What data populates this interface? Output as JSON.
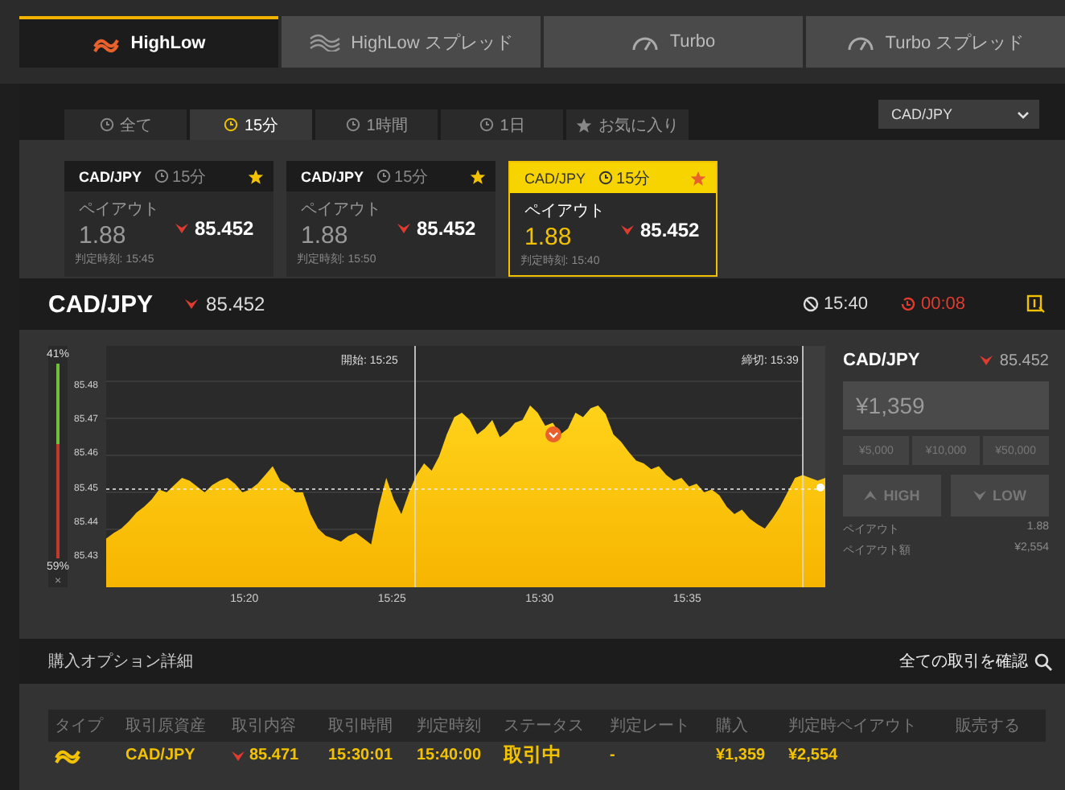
{
  "product_tabs": [
    {
      "label": "HighLow",
      "selected": true
    },
    {
      "label": "HighLow スプレッド",
      "selected": false
    },
    {
      "label": "Turbo",
      "selected": false
    },
    {
      "label": "Turbo スプレッド",
      "selected": false
    }
  ],
  "duration_tabs": [
    {
      "label": "全て",
      "selected": false
    },
    {
      "label": "15分",
      "selected": true
    },
    {
      "label": "1時間",
      "selected": false
    },
    {
      "label": "1日",
      "selected": false
    },
    {
      "label": "お気に入り",
      "selected": false
    }
  ],
  "pair_select": {
    "value": "CAD/JPY"
  },
  "option_cards": [
    {
      "pair": "CAD/JPY",
      "duration": "15分",
      "favorite": true,
      "payout_label": "ペイアウト",
      "payout": "1.88",
      "price": "85.452",
      "expiry": "判定時刻:  15:45",
      "selected": false
    },
    {
      "pair": "CAD/JPY",
      "duration": "15分",
      "favorite": true,
      "payout_label": "ペイアウト",
      "payout": "1.88",
      "price": "85.452",
      "expiry": "判定時刻:  15:50",
      "selected": false
    },
    {
      "pair": "CAD/JPY",
      "duration": "15分",
      "favorite": true,
      "payout_label": "ペイアウト",
      "payout": "1.88",
      "price": "85.452",
      "expiry": "判定時刻:  15:40",
      "selected": true
    }
  ],
  "price_bar": {
    "pair": "CAD/JPY",
    "price": "85.452",
    "expiry": "15:40",
    "countdown": "00:08"
  },
  "sentiment": {
    "high": "41%",
    "low": "59%",
    "level": 0.41,
    "close": "×"
  },
  "chart": {
    "start": "開始: 15:25",
    "end": "締切: 15:39",
    "y_labels": [
      "85.48",
      "85.47",
      "85.46",
      "85.45",
      "85.44",
      "85.43"
    ],
    "x_labels": [
      "15:20",
      "15:25",
      "15:30",
      "15:35"
    ]
  },
  "trade_panel": {
    "pair": "CAD/JPY",
    "price": "85.452",
    "amount": "¥1,359",
    "chips": [
      "¥5,000",
      "¥10,000",
      "¥50,000"
    ],
    "high": "HIGH",
    "low": "LOW",
    "payout_label": "ペイアウト",
    "payout": "1.88",
    "payout_amount_label": "ペイアウト額",
    "payout_amount": "¥2,554"
  },
  "purchased": {
    "title": "購入オプション詳細",
    "link": "全ての取引を確認",
    "columns": [
      "タイプ",
      "取引原資産",
      "取引内容",
      "取引時間",
      "判定時刻",
      "ステータス",
      "判定レート",
      "購入",
      "判定時ペイアウト",
      "販売する"
    ],
    "rows": [
      {
        "asset": "CAD/JPY",
        "rate": "85.471",
        "time": "15:30:01",
        "expiry": "15:40:00",
        "status": "取引中",
        "result_rate": "-",
        "amount": "¥1,359",
        "payout": "¥2,554"
      }
    ]
  }
}
